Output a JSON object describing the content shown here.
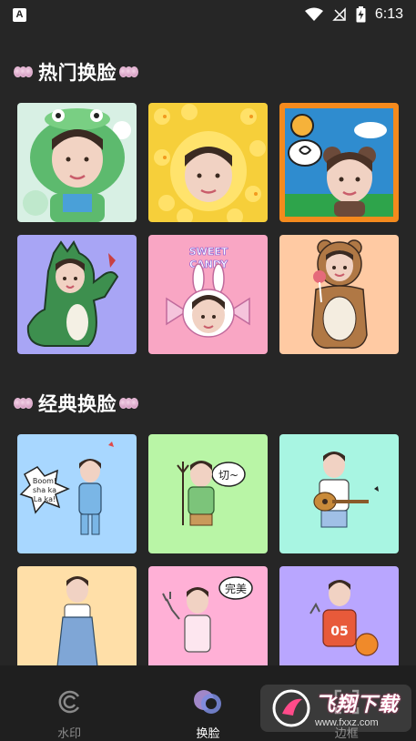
{
  "status_bar": {
    "time": "6:13",
    "app_badge": "A"
  },
  "sections": [
    {
      "title": "热门换脸"
    },
    {
      "title": "经典换脸"
    }
  ],
  "hot_templates": [
    {
      "icon": "dinosaur-hood-template"
    },
    {
      "icon": "chick-hood-template"
    },
    {
      "icon": "bear-ears-comic-template"
    },
    {
      "icon": "green-dinosaur-costume-template"
    },
    {
      "icon": "sweet-candy-bunny-template",
      "text_line1": "SWEET",
      "text_line2": "CANDY"
    },
    {
      "icon": "teddy-bear-costume-template"
    }
  ],
  "classic_templates": [
    {
      "icon": "boom-shakalaka-template",
      "text_lines": [
        "Boom!",
        "sha ka",
        "La ka!"
      ]
    },
    {
      "icon": "devil-trident-template",
      "bubble": "切~"
    },
    {
      "icon": "guitar-player-template"
    },
    {
      "icon": "overalls-kid-template"
    },
    {
      "icon": "rock-hand-template",
      "bubble": "完美"
    },
    {
      "icon": "basketball-05-template",
      "jersey": "05"
    }
  ],
  "bottom_nav": [
    {
      "label": "水印",
      "icon": "watermark-icon",
      "active": false
    },
    {
      "label": "换脸",
      "icon": "faceswap-icon",
      "active": true
    },
    {
      "label": "边框",
      "icon": "frame-icon",
      "active": false
    }
  ],
  "watermark_overlay": {
    "title": "飞翔下载",
    "url": "www.fxxz.com"
  },
  "colors": {
    "background": "#262626",
    "nav_background": "#1f1f1f",
    "nav_inactive": "#8a8a8a",
    "nav_active": "#ffffff"
  }
}
